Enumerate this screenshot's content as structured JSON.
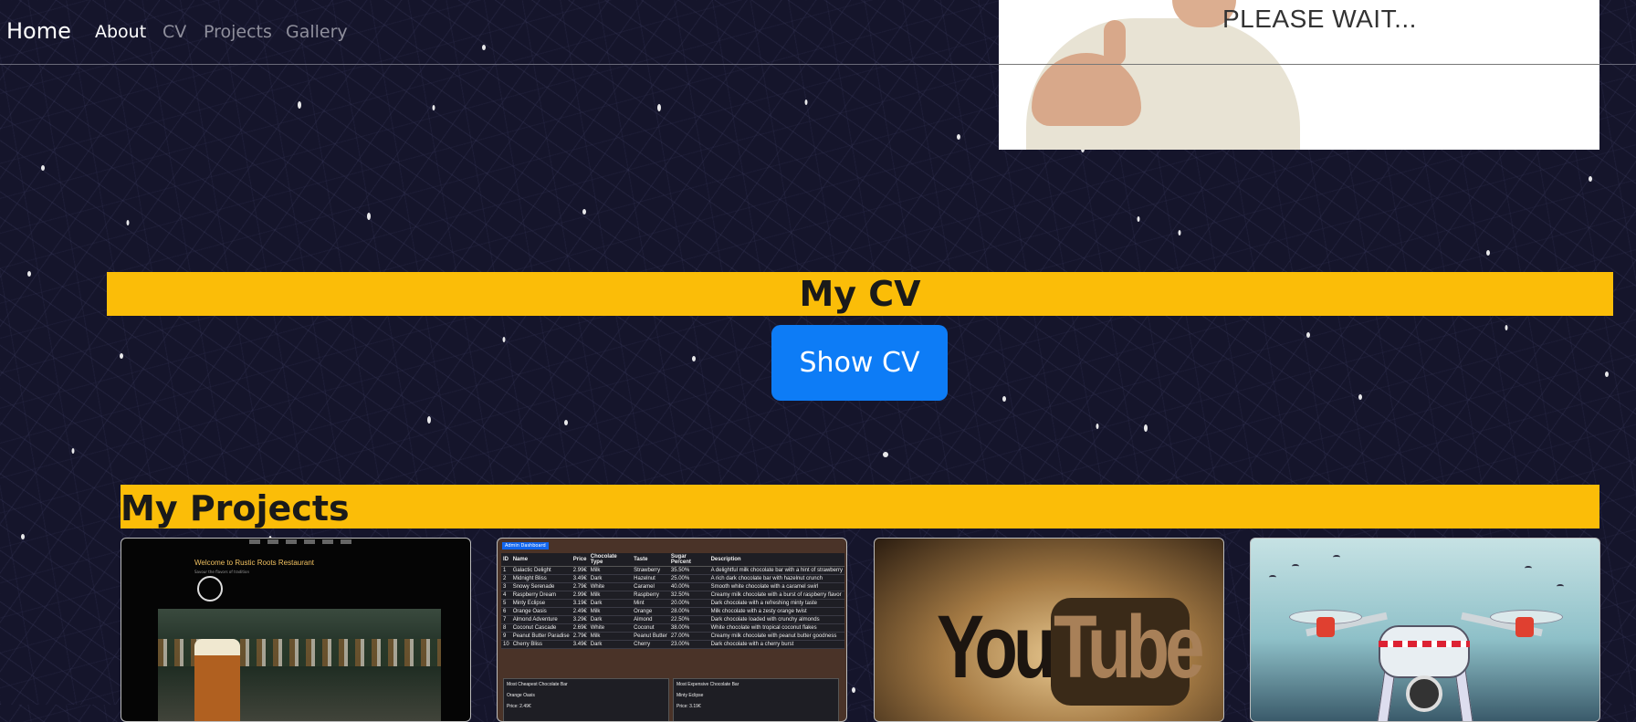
{
  "navbar": {
    "brand": "Home",
    "links": [
      {
        "label": "About",
        "active": true
      },
      {
        "label": "CV",
        "active": false
      },
      {
        "label": "Projects",
        "active": false
      },
      {
        "label": "Gallery",
        "active": false
      }
    ]
  },
  "video_overlay": {
    "text": "PLEASE WAIT..."
  },
  "cv_section": {
    "title": "My CV",
    "button_label": "Show CV"
  },
  "projects_section": {
    "title": "My Projects",
    "cards": [
      {
        "name": "restaurant",
        "heading": "Welcome to Rustic Roots Restaurant",
        "subheading": "Savour the flavors of tradition"
      },
      {
        "name": "chocolate-dashboard",
        "badge": "Admin Dashboard",
        "columns": [
          "ID",
          "Name",
          "Price",
          "Chocolate Type",
          "Taste",
          "Sugar Percent",
          "Description"
        ],
        "rows": [
          [
            "1",
            "Galactic Delight",
            "2.99€",
            "Milk",
            "Strawberry",
            "35.50%",
            "A delightful milk chocolate bar with a hint of strawberry"
          ],
          [
            "2",
            "Midnight Bliss",
            "3.49€",
            "Dark",
            "Hazelnut",
            "25.00%",
            "A rich dark chocolate bar with hazelnut crunch"
          ],
          [
            "3",
            "Snowy Serenade",
            "2.79€",
            "White",
            "Caramel",
            "40.00%",
            "Smooth white chocolate with a caramel swirl"
          ],
          [
            "4",
            "Raspberry Dream",
            "2.99€",
            "Milk",
            "Raspberry",
            "32.50%",
            "Creamy milk chocolate with a burst of raspberry flavor"
          ],
          [
            "5",
            "Minty Eclipse",
            "3.19€",
            "Dark",
            "Mint",
            "20.00%",
            "Dark chocolate with a refreshing minty taste"
          ],
          [
            "6",
            "Orange Oasis",
            "2.49€",
            "Milk",
            "Orange",
            "28.00%",
            "Milk chocolate with a zesty orange twist"
          ],
          [
            "7",
            "Almond Adventure",
            "3.29€",
            "Dark",
            "Almond",
            "22.50%",
            "Dark chocolate loaded with crunchy almonds"
          ],
          [
            "8",
            "Coconut Cascade",
            "2.69€",
            "White",
            "Coconut",
            "38.00%",
            "White chocolate with tropical coconut flakes"
          ],
          [
            "9",
            "Peanut Butter Paradise",
            "2.79€",
            "Milk",
            "Peanut Butter",
            "27.00%",
            "Creamy milk chocolate with peanut butter goodness"
          ],
          [
            "10",
            "Cherry Bliss",
            "3.49€",
            "Dark",
            "Cherry",
            "23.00%",
            "Dark chocolate with a cherry burst"
          ]
        ],
        "box_left": {
          "title": "Most Cheapest Chocolate Bar",
          "value": "Orange Oasis",
          "price": "Price: 2.49€"
        },
        "box_right": {
          "title": "Most Expensive Chocolate Bar",
          "value": "Minty Eclipse",
          "price": "Price: 3.19€"
        }
      },
      {
        "name": "youtube",
        "logo_left": "You",
        "logo_right": "Tube"
      },
      {
        "name": "drone"
      }
    ]
  },
  "colors": {
    "background": "#15152b",
    "section_banner": "#fbbd08",
    "button_primary": "#0d7cf6"
  }
}
